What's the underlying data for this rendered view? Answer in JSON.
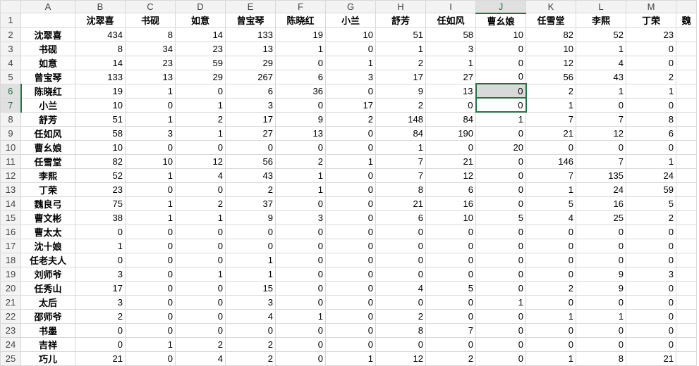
{
  "columns": [
    "A",
    "B",
    "C",
    "D",
    "E",
    "F",
    "G",
    "H",
    "I",
    "J",
    "K",
    "L",
    "M",
    ""
  ],
  "header_names": [
    "沈翠喜",
    "书砚",
    "如意",
    "曾宝琴",
    "陈晓红",
    "小兰",
    "舒芳",
    "任如风",
    "曹幺娘",
    "任雪堂",
    "李熙",
    "丁荣",
    "魏"
  ],
  "rows": [
    {
      "num": "2",
      "name": "沈翠喜",
      "values": [
        "434",
        "8",
        "14",
        "133",
        "19",
        "10",
        "51",
        "58",
        "10",
        "82",
        "52",
        "23"
      ]
    },
    {
      "num": "3",
      "name": "书砚",
      "values": [
        "8",
        "34",
        "23",
        "13",
        "1",
        "0",
        "1",
        "3",
        "0",
        "10",
        "1",
        "0"
      ]
    },
    {
      "num": "4",
      "name": "如意",
      "values": [
        "14",
        "23",
        "59",
        "29",
        "0",
        "1",
        "2",
        "1",
        "0",
        "12",
        "4",
        "0"
      ]
    },
    {
      "num": "5",
      "name": "曾宝琴",
      "values": [
        "133",
        "13",
        "29",
        "267",
        "6",
        "3",
        "17",
        "27",
        "0",
        "56",
        "43",
        "2"
      ]
    },
    {
      "num": "6",
      "name": "陈晓红",
      "values": [
        "19",
        "1",
        "0",
        "6",
        "36",
        "0",
        "9",
        "13",
        "0",
        "2",
        "1",
        "1"
      ]
    },
    {
      "num": "7",
      "name": "小兰",
      "values": [
        "10",
        "0",
        "1",
        "3",
        "0",
        "17",
        "2",
        "0",
        "0",
        "1",
        "0",
        "0"
      ]
    },
    {
      "num": "8",
      "name": "舒芳",
      "values": [
        "51",
        "1",
        "2",
        "17",
        "9",
        "2",
        "148",
        "84",
        "1",
        "7",
        "7",
        "8"
      ]
    },
    {
      "num": "9",
      "name": "任如风",
      "values": [
        "58",
        "3",
        "1",
        "27",
        "13",
        "0",
        "84",
        "190",
        "0",
        "21",
        "12",
        "6"
      ]
    },
    {
      "num": "10",
      "name": "曹幺娘",
      "values": [
        "10",
        "0",
        "0",
        "0",
        "0",
        "0",
        "1",
        "0",
        "20",
        "0",
        "0",
        "0"
      ]
    },
    {
      "num": "11",
      "name": "任雪堂",
      "values": [
        "82",
        "10",
        "12",
        "56",
        "2",
        "1",
        "7",
        "21",
        "0",
        "146",
        "7",
        "1"
      ]
    },
    {
      "num": "12",
      "name": "李熙",
      "values": [
        "52",
        "1",
        "4",
        "43",
        "1",
        "0",
        "7",
        "12",
        "0",
        "7",
        "135",
        "24"
      ]
    },
    {
      "num": "13",
      "name": "丁荣",
      "values": [
        "23",
        "0",
        "0",
        "2",
        "1",
        "0",
        "8",
        "6",
        "0",
        "1",
        "24",
        "59"
      ]
    },
    {
      "num": "14",
      "name": "魏良弓",
      "values": [
        "75",
        "1",
        "2",
        "37",
        "0",
        "0",
        "21",
        "16",
        "0",
        "5",
        "16",
        "5"
      ]
    },
    {
      "num": "15",
      "name": "曹文彬",
      "values": [
        "38",
        "1",
        "1",
        "9",
        "3",
        "0",
        "6",
        "10",
        "5",
        "4",
        "25",
        "2"
      ]
    },
    {
      "num": "16",
      "name": "曹太太",
      "values": [
        "0",
        "0",
        "0",
        "0",
        "0",
        "0",
        "0",
        "0",
        "0",
        "0",
        "0",
        "0"
      ]
    },
    {
      "num": "17",
      "name": "沈十娘",
      "values": [
        "1",
        "0",
        "0",
        "0",
        "0",
        "0",
        "0",
        "0",
        "0",
        "0",
        "0",
        "0"
      ]
    },
    {
      "num": "18",
      "name": "任老夫人",
      "values": [
        "0",
        "0",
        "0",
        "1",
        "0",
        "0",
        "0",
        "0",
        "0",
        "0",
        "0",
        "0"
      ]
    },
    {
      "num": "19",
      "name": "刘师爷",
      "values": [
        "3",
        "0",
        "1",
        "1",
        "0",
        "0",
        "0",
        "0",
        "0",
        "0",
        "9",
        "3"
      ]
    },
    {
      "num": "20",
      "name": "任秀山",
      "values": [
        "17",
        "0",
        "0",
        "15",
        "0",
        "0",
        "4",
        "5",
        "0",
        "2",
        "9",
        "0"
      ]
    },
    {
      "num": "21",
      "name": "太后",
      "values": [
        "3",
        "0",
        "0",
        "3",
        "0",
        "0",
        "0",
        "0",
        "1",
        "0",
        "0",
        "0"
      ]
    },
    {
      "num": "22",
      "name": "邵师爷",
      "values": [
        "2",
        "0",
        "0",
        "4",
        "1",
        "0",
        "2",
        "0",
        "0",
        "1",
        "1",
        "0"
      ]
    },
    {
      "num": "23",
      "name": "书墨",
      "values": [
        "0",
        "0",
        "0",
        "0",
        "0",
        "0",
        "8",
        "7",
        "0",
        "0",
        "0",
        "0"
      ]
    },
    {
      "num": "24",
      "name": "吉祥",
      "values": [
        "0",
        "1",
        "2",
        "2",
        "0",
        "0",
        "0",
        "0",
        "0",
        "0",
        "0",
        "0"
      ]
    },
    {
      "num": "25",
      "name": "巧儿",
      "values": [
        "21",
        "0",
        "4",
        "2",
        "0",
        "1",
        "12",
        "2",
        "0",
        "1",
        "8",
        "21"
      ]
    }
  ]
}
